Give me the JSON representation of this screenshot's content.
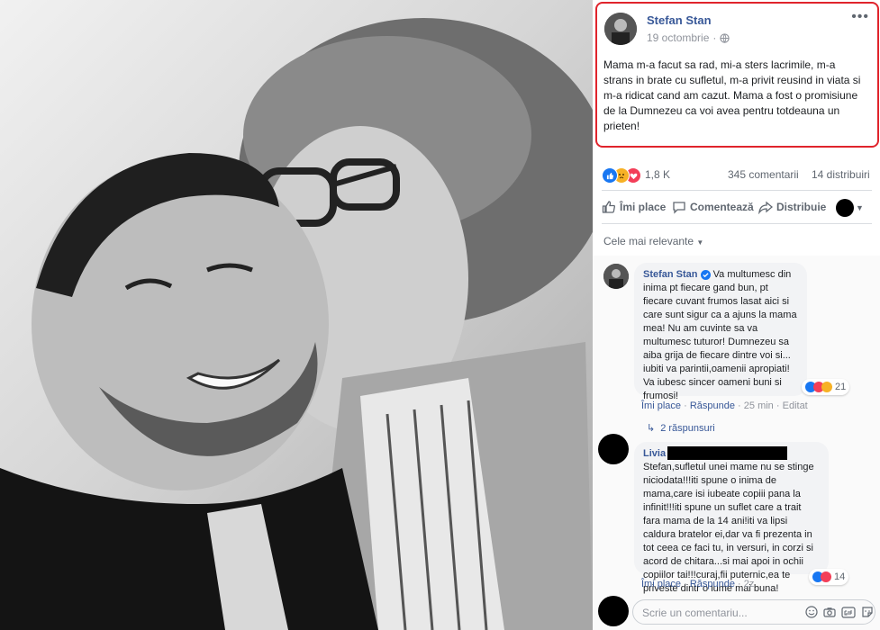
{
  "post": {
    "author": "Stefan Stan",
    "date": "19 octombrie",
    "text": "Mama m-a facut sa rad, mi-a sters lacrimile, m-a strans in brate cu sufletul, m-a privit reusind in viata si m-a ridicat cand am cazut. Mama a fost o promisiune de la Dumnezeu ca voi avea pentru totdeauna un prieten!"
  },
  "stats": {
    "reactions": "1,8 K",
    "comments": "345 comentarii",
    "shares": "14 distribuiri"
  },
  "actions": {
    "like": "Îmi place",
    "comment": "Comentează",
    "share": "Distribuie"
  },
  "sort": {
    "label": "Cele mai relevante"
  },
  "comments": [
    {
      "author": "Stefan Stan",
      "text": "Va multumesc din inima pt fiecare gand bun, pt fiecare cuvant frumos lasat aici si care sunt sigur ca a ajuns la mama mea! Nu am cuvinte sa va multumesc tuturor! Dumnezeu sa aiba grija de fiecare dintre voi si... iubiti va parintii,oamenii apropiati! Va iubesc sincer oameni buni si frumosi!",
      "reactions": "21",
      "like": "Îmi place",
      "reply": "Răspunde",
      "time": "25 min",
      "edited": "Editat",
      "replies": "2 răspunsuri"
    },
    {
      "author": "Livia",
      "text": "Stefan,sufletul unei mame nu se stinge niciodata!!!iti spune o inima de mama,care isi iubeate copiii pana la infinit!!!iti spune un suflet care a trait fara mama de la 14 ani!iti va lipsi caldura bratelor ei,dar va fi prezenta in tot ceea ce faci tu, in versuri, in corzi si acord de chitara...si mai apoi in ochii copiilor tai!!!curaj,fii puternic,ea te priveste dintr o lume mai buna!",
      "reactions": "14",
      "like": "Îmi place",
      "reply": "Răspunde",
      "time": "2z"
    }
  ],
  "input": {
    "placeholder": "Scrie un comentariu..."
  },
  "colors": {
    "link": "#385898",
    "highlight": "#e0242c",
    "like": "#1877f2",
    "love": "#f33e58",
    "haha": "#f7b125"
  },
  "icons": {
    "globe": "globe-icon",
    "like": "thumb-up-icon",
    "comment": "speech-bubble-icon",
    "share": "share-arrow-icon",
    "verified": "verified-badge-icon"
  }
}
